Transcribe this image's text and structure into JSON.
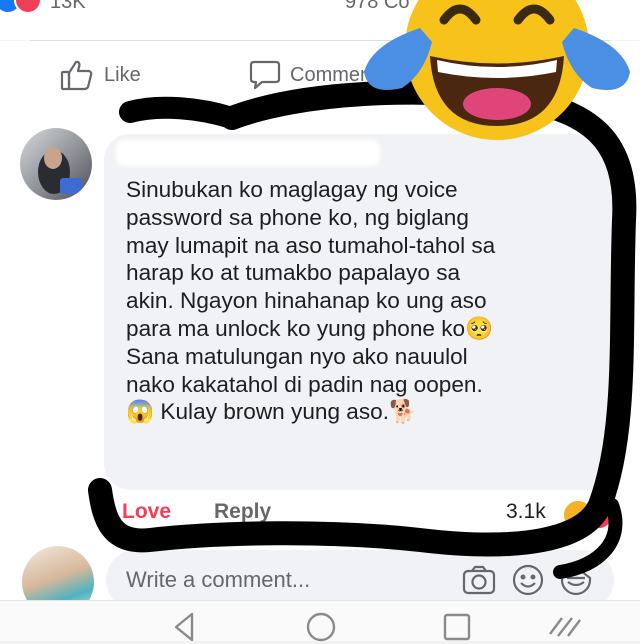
{
  "post_stats": {
    "reaction_count": "13K",
    "comments_shares": "978 Co"
  },
  "action_bar": {
    "like_label": "Like",
    "comment_label": "Comment"
  },
  "comment": {
    "text": "Sinubukan ko maglagay ng voice\npassword sa phone ko, ng biglang\nmay lumapit na aso tumahol-tahol sa\nharap ko at tumakbo papalayo sa\nakin. Ngayon hinahanap ko ung aso\npara ma unlock ko yung phone ko🥺\nSana matulungan nyo ako nauulol\nnako kakatahol di padin nag oopen.\n😱 Kulay brown yung aso.🐕",
    "reacted_label": "Love",
    "reply_label": "Reply",
    "reaction_count": "3.1k"
  },
  "composer": {
    "placeholder": "Write a comment..."
  },
  "colors": {
    "fb_blue": "#1877f2",
    "love_red": "#f33e58",
    "haha_yellow": "#f7b125",
    "scribble": "#000000",
    "bubble_bg": "#f0f2f5",
    "secondary_text": "#65676b"
  },
  "icons": {
    "like": "thumbs-up-icon",
    "comment": "speech-bubble-icon",
    "camera": "camera-icon",
    "emoji": "smiley-icon",
    "sticker": "sticker-icon",
    "overlay": "laughing-tears-emoji",
    "nav": [
      "back-triangle-icon",
      "home-circle-icon",
      "recents-square-icon",
      "menu-icon"
    ]
  }
}
